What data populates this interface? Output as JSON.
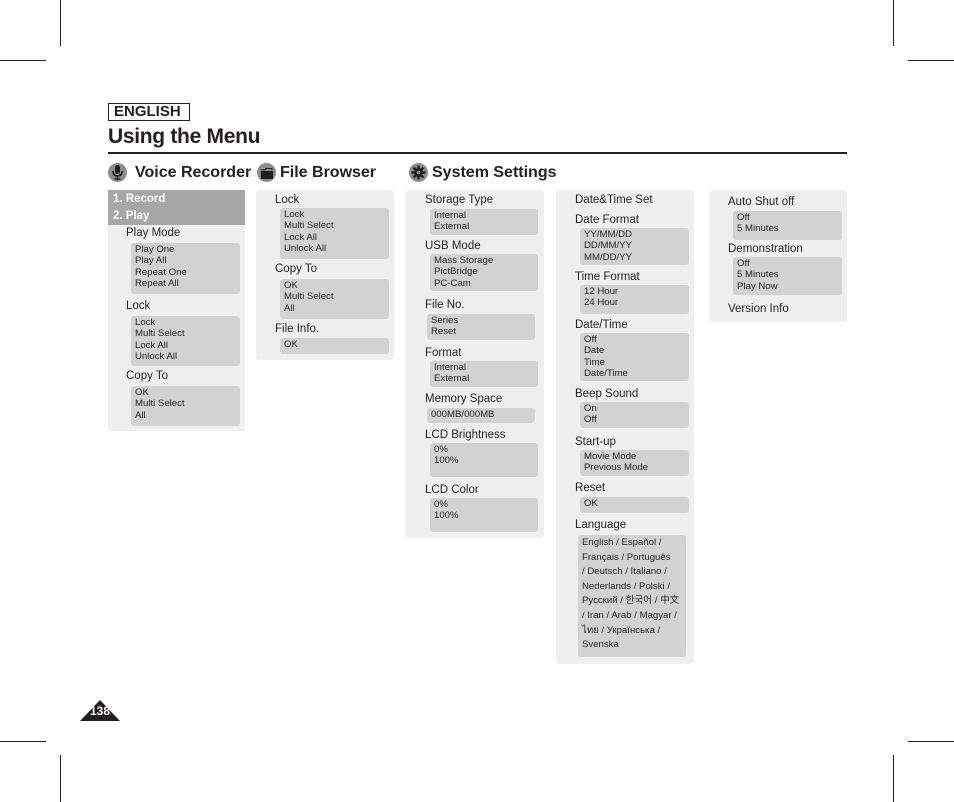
{
  "header": {
    "language_badge": "ENGLISH",
    "title": "Using the Menu"
  },
  "sections": {
    "voice_recorder": {
      "title": "Voice Recorder",
      "icon": "microphone-icon",
      "items": [
        "1. Record",
        "2. Play"
      ],
      "groups": [
        {
          "label": "Play Mode",
          "options": [
            "Play One",
            "Play All",
            "Repeat One",
            "Repeat All"
          ]
        },
        {
          "label": "Lock",
          "options": [
            "Lock",
            "Multi Select",
            "Lock All",
            "Unlock All"
          ]
        },
        {
          "label": "Copy To",
          "options": [
            "OK",
            "Multi Select",
            "All"
          ]
        }
      ]
    },
    "file_browser": {
      "title": "File Browser",
      "icon": "folder-icon",
      "groups": [
        {
          "label": "Lock",
          "options": [
            "Lock",
            "Multi Select",
            "Lock All",
            "Unlock All"
          ]
        },
        {
          "label": "Copy To",
          "options": [
            "OK",
            "Multi Select",
            "All"
          ]
        },
        {
          "label": "File Info.",
          "options": [
            "OK"
          ]
        }
      ]
    },
    "system_settings": {
      "title": "System Settings",
      "icon": "gear-icon",
      "col1": [
        {
          "label": "Storage Type",
          "options": [
            "Internal",
            "External"
          ]
        },
        {
          "label": "USB Mode",
          "options": [
            "Mass Storage",
            "PictBridge",
            "PC-Cam"
          ]
        },
        {
          "label": "File No.",
          "options": [
            "Series",
            "Reset"
          ]
        },
        {
          "label": "Format",
          "options": [
            "Internal",
            "External"
          ]
        },
        {
          "label": "Memory Space",
          "options": [
            "000MB/000MB"
          ]
        },
        {
          "label": "LCD Brightness",
          "options": [
            "0%",
            "100%"
          ]
        },
        {
          "label": "LCD Color",
          "options": [
            "0%",
            "100%"
          ]
        }
      ],
      "col2_header": "Date&Time Set",
      "col2": [
        {
          "label": "Date Format",
          "options": [
            "YY/MM/DD",
            "DD/MM/YY",
            "MM/DD/YY"
          ]
        },
        {
          "label": "Time Format",
          "options": [
            "12 Hour",
            "24 Hour"
          ]
        },
        {
          "label": "Date/Time",
          "options": [
            "Off",
            "Date",
            "Time",
            "Date/Time"
          ]
        },
        {
          "label": "Beep Sound",
          "options": [
            "On",
            "Off"
          ]
        },
        {
          "label": "Start-up",
          "options": [
            "Movie Mode",
            "Previous Mode"
          ]
        },
        {
          "label": "Reset",
          "options": [
            "OK"
          ]
        },
        {
          "label": "Language",
          "options": [
            "English / Español /",
            "Français / Português",
            "/ Deutsch / Italiano /",
            "Nederlands / Polski /",
            "Русский /  한국어 / 中文",
            "/ Iran / Arab / Magyar /",
            "ไทย / Українська /",
            "Svenska"
          ]
        }
      ],
      "col3": [
        {
          "label": "Auto Shut off",
          "options": [
            "Off",
            "5 Minutes"
          ]
        },
        {
          "label": "Demonstration",
          "options": [
            "Off",
            "5 Minutes",
            "Play Now"
          ]
        },
        {
          "label": "Version Info",
          "options": []
        }
      ]
    }
  },
  "footer": {
    "page_number": "138"
  }
}
